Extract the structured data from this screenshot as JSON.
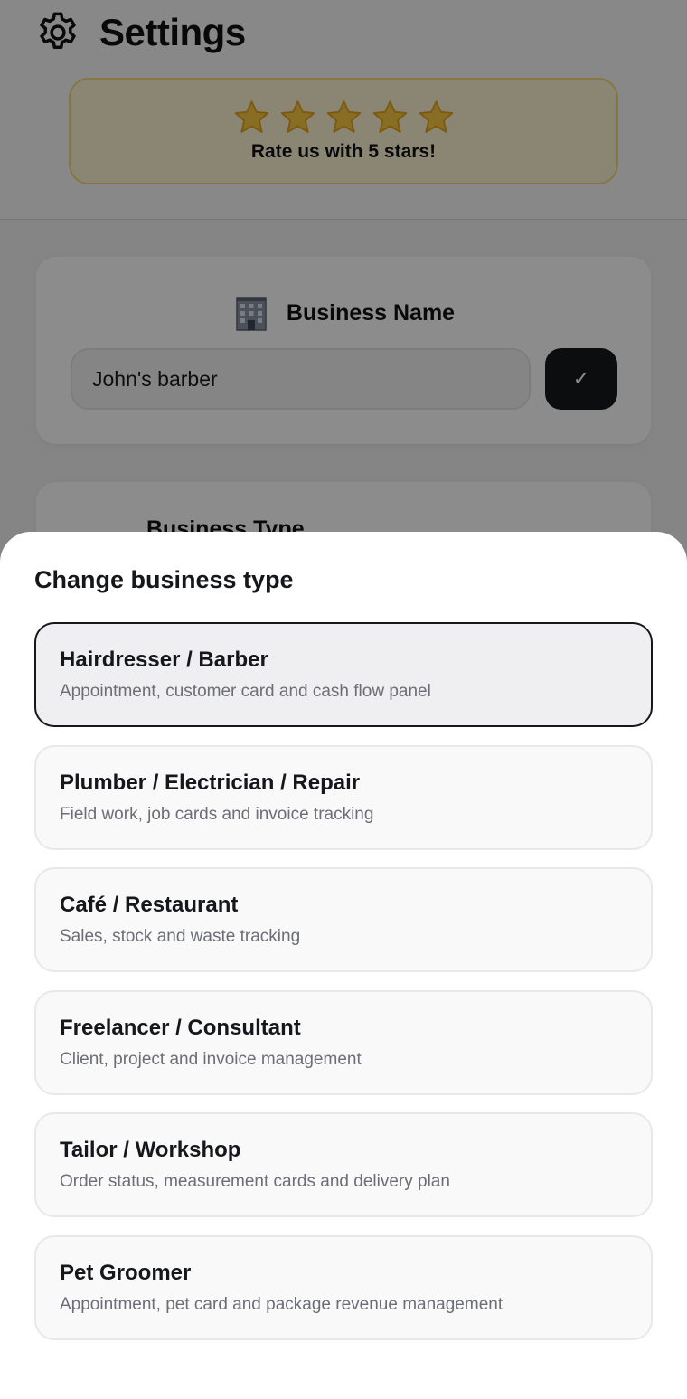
{
  "header": {
    "title": "Settings",
    "gear_icon": "gear-icon",
    "rating": {
      "stars": 5,
      "text": "Rate us with 5 stars!",
      "star_icon": "star-icon"
    }
  },
  "business_name_card": {
    "icon": "office-building-icon",
    "title": "Business Name",
    "value": "John's barber",
    "confirm_label": "✓"
  },
  "business_type_card": {
    "title": "Business Type"
  },
  "sheet": {
    "title": "Change business type",
    "selected_index": 0,
    "options": [
      {
        "title": "Hairdresser / Barber",
        "description": "Appointment, customer card and cash flow panel"
      },
      {
        "title": "Plumber / Electrician / Repair",
        "description": "Field work, job cards and invoice tracking"
      },
      {
        "title": "Café / Restaurant",
        "description": "Sales, stock and waste tracking"
      },
      {
        "title": "Freelancer / Consultant",
        "description": "Client, project and invoice management"
      },
      {
        "title": "Tailor / Workshop",
        "description": "Order status, measurement cards and delivery plan"
      },
      {
        "title": "Pet Groomer",
        "description": "Appointment, pet card and package revenue management"
      }
    ]
  },
  "colors": {
    "accent_dark": "#16171b",
    "rating_bg": "#fdf3d3",
    "rating_border": "#f3d77a",
    "star_gold": "#f5b82e",
    "overlay": "rgba(0,0,0,0.45)"
  }
}
